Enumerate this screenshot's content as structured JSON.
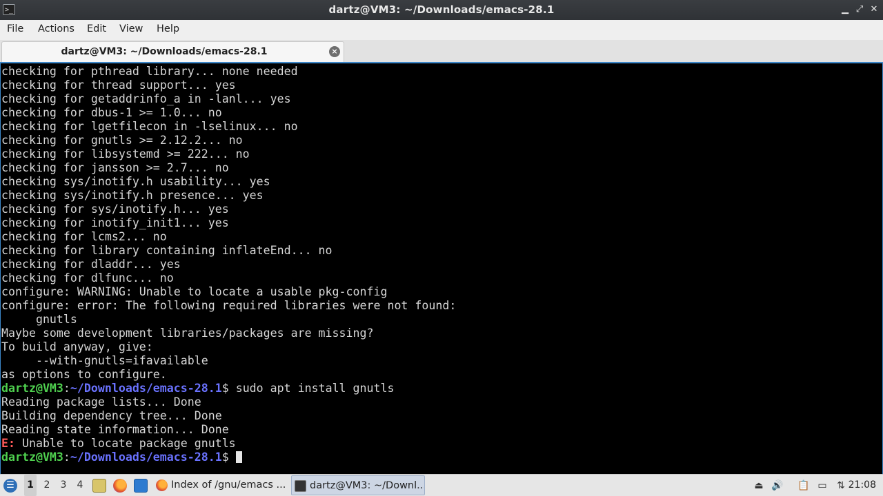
{
  "window": {
    "title": "dartz@VM3: ~/Downloads/emacs-28.1",
    "minimize_glyph": "▁",
    "maximize_glyph": "⤢",
    "close_glyph": "✕"
  },
  "menubar": {
    "items": [
      "File",
      "Actions",
      "Edit",
      "View",
      "Help"
    ]
  },
  "tabs": [
    {
      "label": "dartz@VM3: ~/Downloads/emacs-28.1",
      "close_glyph": "×"
    }
  ],
  "terminal": {
    "colors": {
      "background": "#000000",
      "text": "#d6d6d6",
      "prompt_user": "#4fd14f",
      "prompt_path": "#6a72ff",
      "error": "#ff5a5a"
    },
    "output_lines_1": [
      "checking for pthread library... none needed",
      "checking for thread support... yes",
      "checking for getaddrinfo_a in -lanl... yes",
      "checking for dbus-1 >= 1.0... no",
      "checking for lgetfilecon in -lselinux... no",
      "checking for gnutls >= 2.12.2... no",
      "checking for libsystemd >= 222... no",
      "checking for jansson >= 2.7... no",
      "checking sys/inotify.h usability... yes",
      "checking sys/inotify.h presence... yes",
      "checking for sys/inotify.h... yes",
      "checking for inotify_init1... yes",
      "checking for lcms2... no",
      "checking for library containing inflateEnd... no",
      "checking for dladdr... yes",
      "checking for dlfunc... no",
      "configure: WARNING: Unable to locate a usable pkg-config",
      "configure: error: The following required libraries were not found:",
      "     gnutls",
      "Maybe some development libraries/packages are missing?",
      "To build anyway, give:",
      "     --with-gnutls=ifavailable",
      "as options to configure."
    ],
    "prompt_user": "dartz@VM3",
    "prompt_sep": ":",
    "prompt_path": "~/Downloads/emacs-28.1",
    "prompt_dollar": "$ ",
    "command_1": "sudo apt install gnutls",
    "output_lines_2": [
      "Reading package lists... Done",
      "Building dependency tree... Done",
      "Reading state information... Done"
    ],
    "error_prefix": "E:",
    "error_message": " Unable to locate package gnutls"
  },
  "taskbar": {
    "start_icon": "lubuntu-start-icon",
    "workspaces": [
      "1",
      "2",
      "3",
      "4"
    ],
    "active_workspace": "1",
    "quicklaunch": [
      "file-manager-icon",
      "firefox-icon",
      "show-desktop-icon"
    ],
    "tasks": [
      {
        "label": "Index of /gnu/emacs ...",
        "icon": "firefox-icon",
        "active": false
      },
      {
        "label": "dartz@VM3: ~/Downl...",
        "icon": "terminal-icon",
        "active": true
      }
    ],
    "tray": [
      "notification-icon",
      "volume-icon",
      "clipboard-icon",
      "display-icon",
      "network-icon"
    ],
    "clock": "21:08"
  }
}
